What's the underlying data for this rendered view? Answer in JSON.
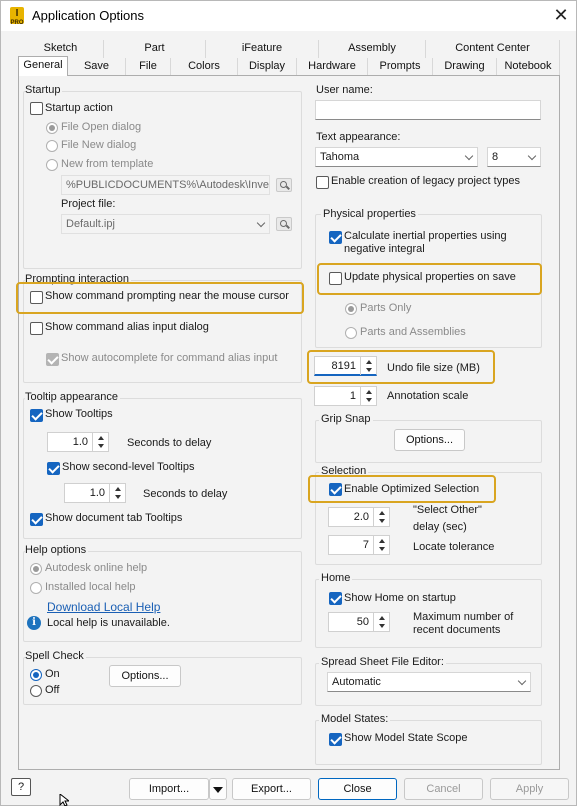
{
  "window": {
    "title": "Application Options"
  },
  "tabs_row1": [
    "Sketch",
    "Part",
    "iFeature",
    "Assembly",
    "Content Center"
  ],
  "tabs_row2": [
    "General",
    "Save",
    "File",
    "Colors",
    "Display",
    "Hardware",
    "Prompts",
    "Drawing",
    "Notebook"
  ],
  "startup": {
    "group_label": "Startup",
    "startup_action": "Startup action",
    "file_open_dialog": "File Open dialog",
    "file_new_dialog": "File New dialog",
    "new_from_template": "New from template",
    "template_path": "%PUBLICDOCUMENTS%\\Autodesk\\Invent",
    "project_file_label": "Project file:",
    "project_file_value": "Default.ipj"
  },
  "prompting": {
    "group_label": "Prompting interaction",
    "show_command_prompting": "Show command prompting near the mouse cursor",
    "show_command_alias": "Show command alias input dialog",
    "show_autocomplete": "Show autocomplete for command alias input"
  },
  "tooltip": {
    "group_label": "Tooltip appearance",
    "show_tooltips": "Show Tooltips",
    "delay1_value": "1.0",
    "delay1_label": "Seconds to delay",
    "show_second_level": "Show second-level Tooltips",
    "delay2_value": "1.0",
    "delay2_label": "Seconds to delay",
    "show_document_tab": "Show document tab Tooltips"
  },
  "help": {
    "group_label": "Help options",
    "online_help": "Autodesk online help",
    "local_help": "Installed local help",
    "download_link": "Download Local Help",
    "unavailable": "Local help is unavailable."
  },
  "spell": {
    "group_label": "Spell Check",
    "on": "On",
    "off": "Off",
    "options_button": "Options..."
  },
  "user": {
    "label": "User name:",
    "value": ""
  },
  "text_appearance": {
    "label": "Text appearance:",
    "font": "Tahoma",
    "size": "8",
    "legacy_projects": "Enable creation of legacy project types"
  },
  "physical": {
    "group_label": "Physical properties",
    "calc_inertial": "Calculate inertial properties using negative integral",
    "update_on_save": "Update physical properties on save",
    "parts_only": "Parts Only",
    "parts_and_assemblies": "Parts and Assemblies"
  },
  "undo": {
    "value": "8191",
    "label": "Undo file size (MB)"
  },
  "annotation": {
    "value": "1",
    "label": "Annotation scale"
  },
  "grip": {
    "group_label": "Grip Snap",
    "options_button": "Options..."
  },
  "selection": {
    "group_label": "Selection",
    "enable_optimized": "Enable Optimized Selection",
    "select_other_value": "2.0",
    "select_other_label_1": "\"Select Other\"",
    "select_other_label_2": "delay (sec)",
    "locate_value": "7",
    "locate_label": "Locate tolerance"
  },
  "home": {
    "group_label": "Home",
    "show_home": "Show Home on startup",
    "max_recent_value": "50",
    "max_recent_label_1": "Maximum number of",
    "max_recent_label_2": "recent documents"
  },
  "spreadsheet": {
    "group_label": "Spread Sheet File Editor:",
    "value": "Automatic"
  },
  "model_states": {
    "group_label": "Model States:",
    "show_scope": "Show Model State Scope"
  },
  "footer": {
    "help_icon": "?",
    "import": "Import...",
    "export": "Export...",
    "close": "Close",
    "cancel": "Cancel",
    "apply": "Apply"
  },
  "colors": {
    "accent": "#1565c0",
    "highlight": "#d9a520"
  }
}
